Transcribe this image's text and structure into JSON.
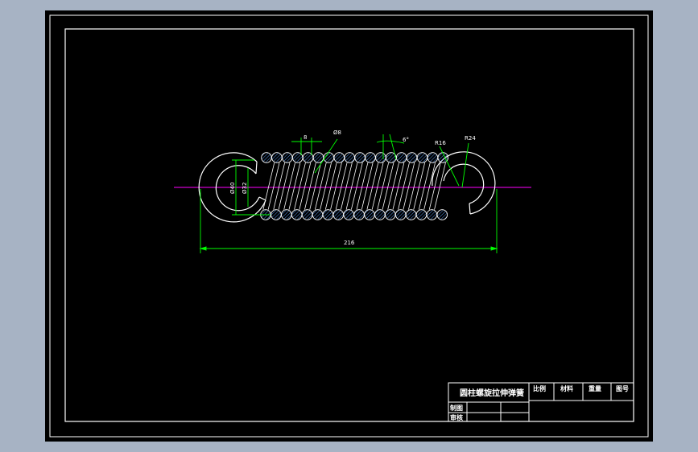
{
  "drawing": {
    "dimensions": {
      "pitch": "8",
      "wire_diameter": "Ø8",
      "angle": "6°",
      "radius_inner": "R16",
      "radius_outer": "R24",
      "diameter_outer": "Ø40",
      "diameter_inner": "Ø32",
      "length": "216"
    },
    "coil_count": 18
  },
  "title_block": {
    "title": "圆柱螺旋拉伸弹簧",
    "scale_label": "比例",
    "material_label": "材料",
    "weight_label": "重量",
    "drawing_no_label": "图号",
    "drawn_label": "制图",
    "checked_label": "审核"
  },
  "colors": {
    "background": "#000000",
    "outer_margin": "#a7b3c4",
    "outline": "#ffffff",
    "dimension": "#00ff00",
    "centerline": "#ff00ff",
    "hatch": "#5aa0ff"
  }
}
